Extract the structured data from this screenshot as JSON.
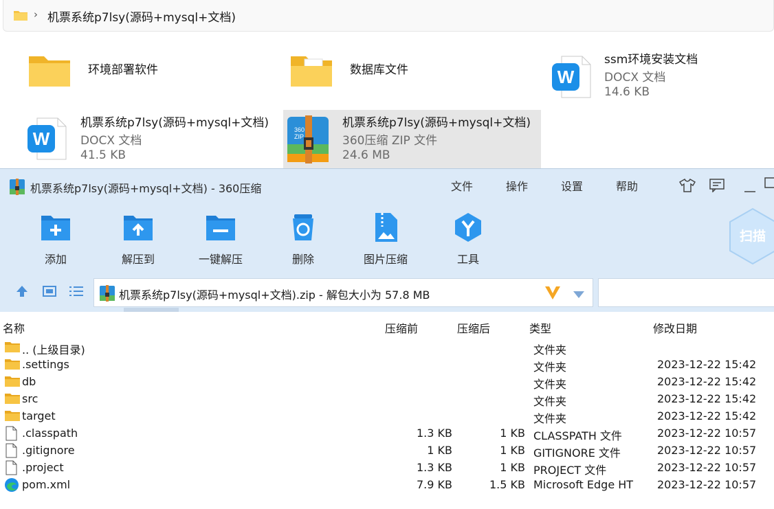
{
  "explorer": {
    "breadcrumb": "机票系统p7lsy(源码+mysql+文档)",
    "tiles": [
      {
        "name": "环境部署软件",
        "icon": "folder-icon"
      },
      {
        "name": "数据库文件",
        "icon": "folder-with-docs-icon"
      },
      {
        "name": "ssm环境安装文档",
        "type": "DOCX 文档",
        "size": "14.6 KB",
        "icon": "word-doc-icon"
      },
      {
        "name": "机票系统p7lsy(源码+mysql+文档)",
        "type": "DOCX 文档",
        "size": "41.5 KB",
        "icon": "word-doc-icon"
      },
      {
        "name": "机票系统p7lsy(源码+mysql+文档)",
        "type": "360压缩 ZIP 文件",
        "size": "24.6 MB",
        "icon": "zip-archive-icon",
        "selected": true
      }
    ]
  },
  "zip": {
    "title": "机票系统p7lsy(源码+mysql+文档) - 360压缩",
    "menu": {
      "file": "文件",
      "ops": "操作",
      "settings": "设置",
      "help": "帮助"
    },
    "tools": {
      "add": "添加",
      "extract_to": "解压到",
      "one_click": "一键解压",
      "delete": "删除",
      "image_compress": "图片压缩",
      "tools": "工具"
    },
    "scan_label": "扫描",
    "path": "机票系统p7lsy(源码+mysql+文档).zip - 解包大小为 57.8 MB",
    "columns": {
      "name": "名称",
      "before": "压缩前",
      "after": "压缩后",
      "type": "类型",
      "modified": "修改日期"
    },
    "rows": [
      {
        "name": ".. (上级目录)",
        "before": "",
        "after": "",
        "type": "文件夹",
        "date": "",
        "icon": "folder-icon"
      },
      {
        "name": ".settings",
        "before": "",
        "after": "",
        "type": "文件夹",
        "date": "2023-12-22 15:42",
        "icon": "folder-icon"
      },
      {
        "name": "db",
        "before": "",
        "after": "",
        "type": "文件夹",
        "date": "2023-12-22 15:42",
        "icon": "folder-icon"
      },
      {
        "name": "src",
        "before": "",
        "after": "",
        "type": "文件夹",
        "date": "2023-12-22 15:42",
        "icon": "folder-icon"
      },
      {
        "name": "target",
        "before": "",
        "after": "",
        "type": "文件夹",
        "date": "2023-12-22 15:42",
        "icon": "folder-icon"
      },
      {
        "name": ".classpath",
        "before": "1.3 KB",
        "after": "1 KB",
        "type": "CLASSPATH 文件",
        "date": "2023-12-22 10:57",
        "icon": "file-icon"
      },
      {
        "name": ".gitignore",
        "before": "1 KB",
        "after": "1 KB",
        "type": "GITIGNORE 文件",
        "date": "2023-12-22 10:57",
        "icon": "file-icon"
      },
      {
        "name": ".project",
        "before": "1.3 KB",
        "after": "1 KB",
        "type": "PROJECT 文件",
        "date": "2023-12-22 10:57",
        "icon": "file-icon"
      },
      {
        "name": "pom.xml",
        "before": "7.9 KB",
        "after": "1.5 KB",
        "type": "Microsoft Edge HT",
        "date": "2023-12-22 10:57",
        "icon": "edge-icon"
      }
    ]
  },
  "colors": {
    "accent_blue": "#1b8fe8",
    "folder_yellow": "#f7c443",
    "toolbar_bg": "#dceaf8"
  }
}
